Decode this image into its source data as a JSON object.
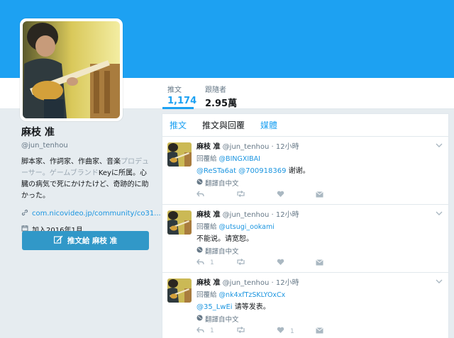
{
  "profile": {
    "name": "麻枝 准",
    "handle": "@jun_tenhou",
    "bio_parts": [
      "脚本家、作詞家、作曲家、音楽",
      "プロデューサー。ゲームブランド",
      "Keyに所属。心臓の病気で死にかけたけど、",
      "奇跡的に",
      "助かった。"
    ],
    "link": "com.nicovideo.jp/community/co31...",
    "joined": "加入2016年1月",
    "tweet_to_button": "推文給 麻枝 准"
  },
  "stats": [
    {
      "label": "推文",
      "value": "1,174"
    },
    {
      "label": "跟隨者",
      "value": "2.95萬"
    }
  ],
  "tabs": [
    "推文",
    "推文與回覆",
    "媒體"
  ],
  "tweets": [
    {
      "name": "麻枝 准",
      "handle": "@jun_tenhou",
      "time": "· 12小時",
      "reply_prefix": "回覆給",
      "reply_to": "@BINGXIBAI",
      "mentions": "@ReSTa6at @700918369",
      "text": " 谢谢。",
      "translate": "翻譯自中文",
      "reply_count": "",
      "like_count": ""
    },
    {
      "name": "麻枝 准",
      "handle": "@jun_tenhou",
      "time": "· 12小時",
      "reply_prefix": "回覆給",
      "reply_to": "@utsugi_ookami",
      "mentions": "",
      "text": "不能说。请宽恕。",
      "translate": "翻譯自中文",
      "reply_count": "1",
      "like_count": ""
    },
    {
      "name": "麻枝 准",
      "handle": "@jun_tenhou",
      "time": "· 12小時",
      "reply_prefix": "回覆給",
      "reply_to": "@nk4xfTzSKLYOxCx",
      "mentions": "@35_LwEi",
      "text": " 请等发表。",
      "translate": "翻譯自中文",
      "reply_count": "1",
      "like_count": "1"
    }
  ],
  "icons": [
    "link-icon",
    "calendar-icon",
    "quill-icon",
    "globe-icon",
    "reply-icon",
    "retweet-icon",
    "heart-icon",
    "dm-icon",
    "chevron-down-icon"
  ],
  "colors": {
    "banner": "#1da1f2",
    "link": "#1b95e0",
    "button": "#3198c8",
    "background": "#e6ecf0"
  }
}
